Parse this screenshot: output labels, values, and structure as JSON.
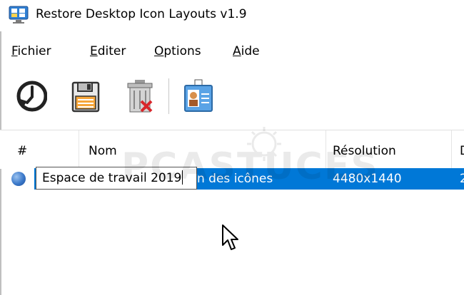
{
  "window": {
    "title": "Restore Desktop Icon Layouts v1.9"
  },
  "menu": [
    {
      "first": "F",
      "rest": "ichier"
    },
    {
      "first": "E",
      "rest": "diter"
    },
    {
      "first": "O",
      "rest": "ptions"
    },
    {
      "first": "A",
      "rest": "ide"
    }
  ],
  "toolbar": {
    "buttons": [
      "restore-layout-icon",
      "save-layout-icon",
      "delete-layout-icon",
      "layout-info-icon"
    ]
  },
  "list": {
    "headers": {
      "num": "#",
      "name": "Nom",
      "resolution": "Résolution",
      "next": "D"
    },
    "rows": [
      {
        "name_tail": "n des icônes",
        "resolution": "4480x1440",
        "next": "2"
      }
    ]
  },
  "editor": {
    "value": "Espace de travail 2019"
  },
  "watermark": {
    "text": "PCASTUCES"
  },
  "colors": {
    "selection": "#0078d7"
  }
}
